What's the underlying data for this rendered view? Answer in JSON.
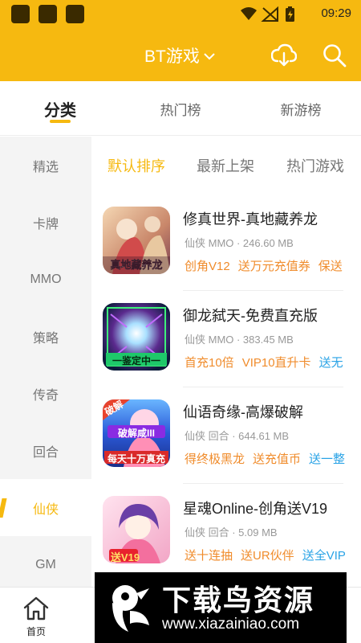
{
  "status_bar": {
    "time": "09:29",
    "icons": [
      "notification-square-icon",
      "notification-square-icon",
      "notification-square-icon",
      "wifi-icon",
      "no-signal-icon",
      "battery-charging-icon"
    ]
  },
  "header": {
    "title": "BT游戏",
    "actions": [
      "cloud-download-icon",
      "search-icon"
    ]
  },
  "tabs": [
    {
      "label": "分类",
      "active": true
    },
    {
      "label": "热门榜",
      "active": false
    },
    {
      "label": "新游榜",
      "active": false
    }
  ],
  "sidebar": {
    "items": [
      {
        "label": "精选",
        "active": false
      },
      {
        "label": "卡牌",
        "active": false
      },
      {
        "label": "MMO",
        "active": false
      },
      {
        "label": "策略",
        "active": false
      },
      {
        "label": "传奇",
        "active": false
      },
      {
        "label": "回合",
        "active": false
      },
      {
        "label": "仙侠",
        "active": true
      },
      {
        "label": "GM",
        "active": false
      }
    ]
  },
  "sort": {
    "items": [
      {
        "label": "默认排序",
        "active": true
      },
      {
        "label": "最新上架",
        "active": false
      },
      {
        "label": "热门游戏",
        "active": false
      }
    ]
  },
  "games": [
    {
      "name": "修真世界-真地藏养龙",
      "meta": "仙侠 MMO · 246.60 MB",
      "thumb_text": "真地藏养龙",
      "tags": [
        {
          "text": "创角V12",
          "color": "#f08c2c"
        },
        {
          "text": "送万元充值券",
          "color": "#f08c2c"
        },
        {
          "text": "保送",
          "color": "#f08c2c"
        }
      ]
    },
    {
      "name": "御龙弑天-免费直充版",
      "meta": "仙侠 MMO · 383.45 MB",
      "thumb_text": "一鉴定中一",
      "tags": [
        {
          "text": "首充10倍",
          "color": "#f08c2c"
        },
        {
          "text": "VIP10直升卡",
          "color": "#f08c2c"
        },
        {
          "text": "送无",
          "color": "#2aa3e6"
        }
      ]
    },
    {
      "name": "仙语奇缘-高爆破解",
      "meta": "仙侠 回合 · 644.61 MB",
      "thumb_text": "每天十万真充",
      "thumb_badge": "破解",
      "thumb_badge2": "破解咸III",
      "tags": [
        {
          "text": "得终极黑龙",
          "color": "#f08c2c"
        },
        {
          "text": "送充值币",
          "color": "#f08c2c"
        },
        {
          "text": "送一整",
          "color": "#2aa3e6"
        }
      ]
    },
    {
      "name": "星魂Online-创角送V19",
      "meta": "仙侠 回合 · 5.09 MB",
      "thumb_text": "送V19",
      "tags": [
        {
          "text": "送十连抽",
          "color": "#f08c2c"
        },
        {
          "text": "送UR伙伴",
          "color": "#f08c2c"
        },
        {
          "text": "送全VIP",
          "color": "#2aa3e6"
        }
      ]
    }
  ],
  "bottom_nav": {
    "home_label": "首页"
  },
  "watermark": {
    "title": "下载鸟资源",
    "url": "www.xiazainiao.com"
  },
  "colors": {
    "accent": "#f6b910",
    "tag_orange": "#f08c2c",
    "tag_blue": "#2aa3e6",
    "sidebar_bg": "#f4f4f4"
  }
}
